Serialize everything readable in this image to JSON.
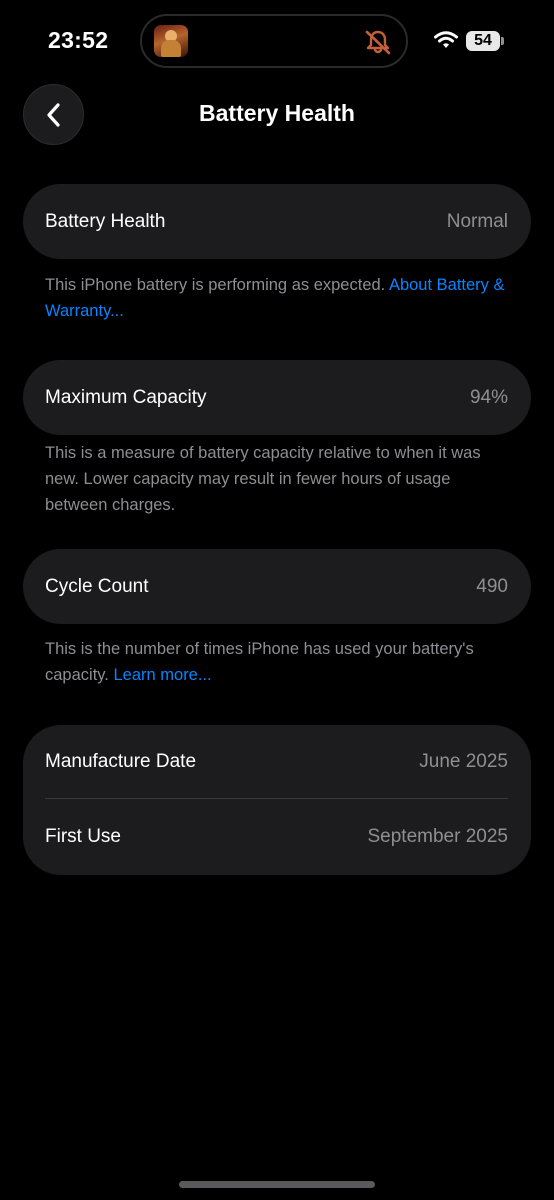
{
  "status_bar": {
    "time": "23:52",
    "battery_level": "54",
    "icons": [
      "now-playing-artwork",
      "muted-bell-icon",
      "wifi-icon",
      "battery-icon"
    ]
  },
  "nav": {
    "title": "Battery Health",
    "back_icon": "chevron-left-icon"
  },
  "battery_health": {
    "label": "Battery Health",
    "value": "Normal",
    "footnote": "This iPhone battery is performing as expected. ",
    "link": "About Battery & Warranty..."
  },
  "maximum_capacity": {
    "label": "Maximum Capacity",
    "value": "94%",
    "footnote": "This is a measure of battery capacity relative to when it was new. Lower capacity may result in fewer hours of usage between charges."
  },
  "cycle_count": {
    "label": "Cycle Count",
    "value": "490",
    "footnote": "This is the number of times iPhone has used your battery's capacity. ",
    "link": "Learn more..."
  },
  "dates": {
    "manufacture_label": "Manufacture Date",
    "manufacture_value": "June 2025",
    "first_use_label": "First Use",
    "first_use_value": "September 2025"
  },
  "colors": {
    "background": "#000000",
    "card": "#1c1c1e",
    "secondary_text": "#8e8e93",
    "link": "#0a84ff"
  }
}
